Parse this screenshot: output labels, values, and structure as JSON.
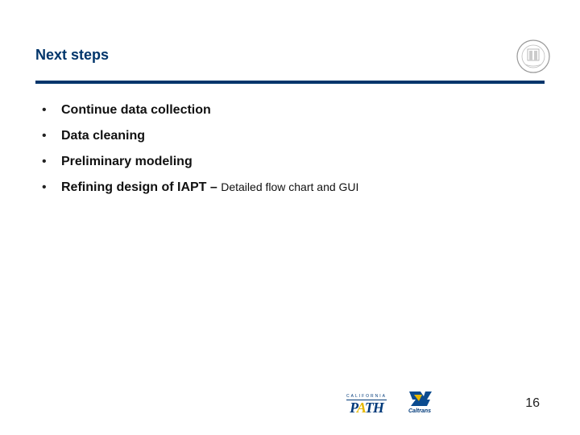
{
  "title": "Next steps",
  "seal_name": "institution-seal",
  "bullets": [
    {
      "text": "Continue data collection",
      "detail": ""
    },
    {
      "text": "Data cleaning",
      "detail": ""
    },
    {
      "text": "Preliminary modeling",
      "detail": ""
    },
    {
      "text": "Refining design of IAPT – ",
      "detail": "Detailed flow chart and GUI"
    }
  ],
  "logos": {
    "path": {
      "tag": "CALIFORNIA",
      "name": "PATH"
    },
    "caltrans": {
      "name": "Caltrans"
    }
  },
  "page_number": "16"
}
